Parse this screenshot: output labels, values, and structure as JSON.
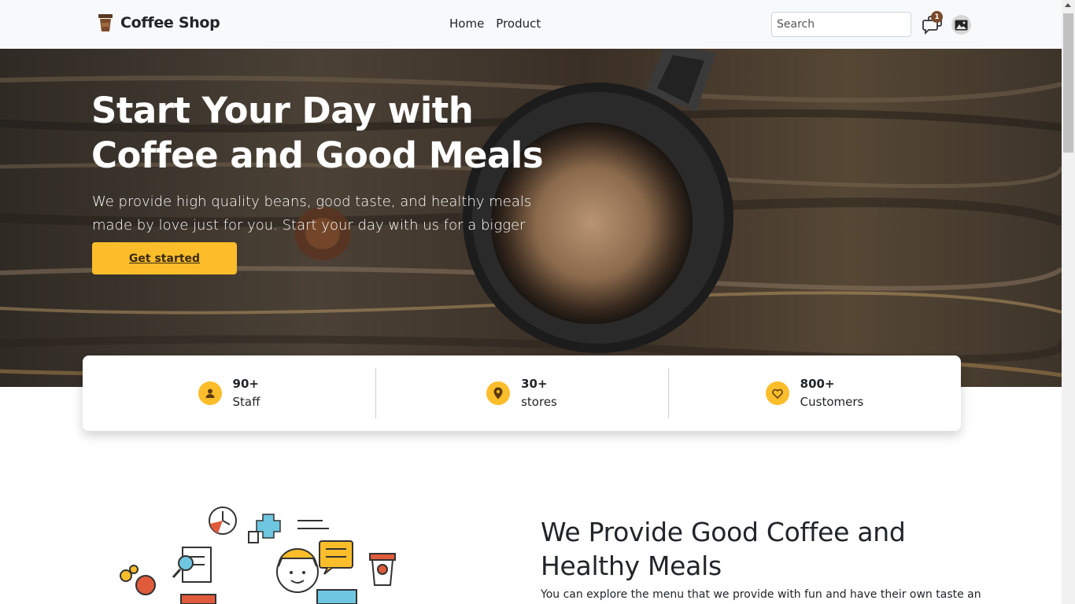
{
  "nav": {
    "brand": "Coffee Shop",
    "brand_icon": "coffee-cup-icon",
    "links": [
      "Home",
      "Product"
    ],
    "search_placeholder": "Search",
    "notification_count": "1",
    "message_icon": "chat-bubbles-icon",
    "avatar_icon": "image-icon"
  },
  "hero": {
    "title_line1": "Start Your Day with",
    "title_line2": "Coffee and Good Meals",
    "subtitle_line1": "We provide high quality beans, good taste, and healthy meals",
    "subtitle_line2": "made by love just for you. Start your day with us for a bigger smile!",
    "cta": "Get started"
  },
  "stats": [
    {
      "value": "90+",
      "label": "Staff",
      "icon": "user-icon"
    },
    {
      "value": "30+",
      "label": "stores",
      "icon": "map-pin-icon"
    },
    {
      "value": "800+",
      "label": "Customers",
      "icon": "heart-icon"
    }
  ],
  "about": {
    "title_line1": "We Provide Good Coffee and",
    "title_line2": "Healthy Meals",
    "text": "You can explore the menu that we provide with fun and have their own taste and"
  },
  "colors": {
    "accent": "#fbbd2a",
    "navbar_bg": "#f8f9fa",
    "badge": "#7b4a2a"
  }
}
